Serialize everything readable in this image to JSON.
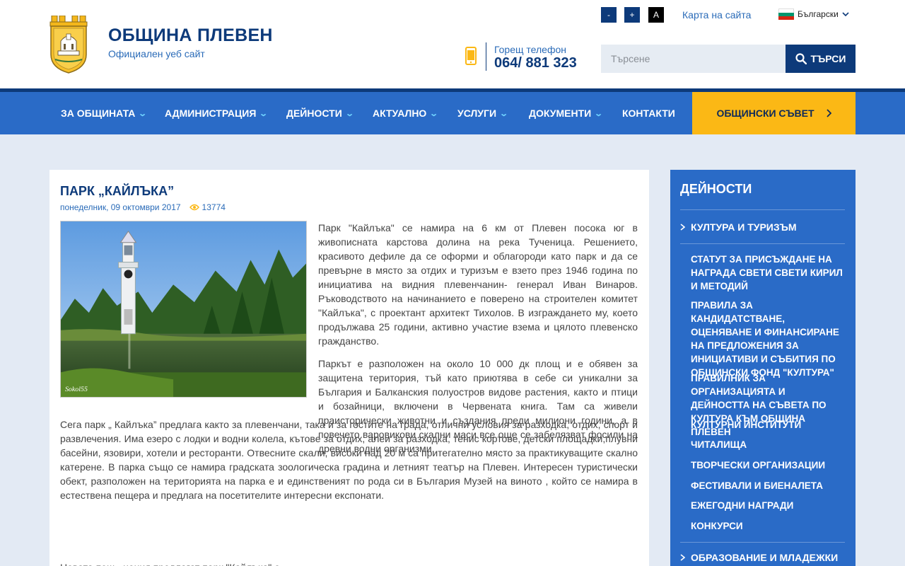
{
  "header": {
    "site_title": "ОБЩИНА ПЛЕВЕН",
    "site_subtitle": "Официален уеб сайт",
    "hotline_label": "Горещ телефон",
    "hotline_number": "064/ 881 323",
    "font_decrease": "-",
    "font_increase": "+",
    "contrast": "A",
    "sitemap": "Карта на сайта",
    "language": "Български",
    "search_placeholder": "Търсене",
    "search_button": "ТЪРСИ"
  },
  "nav": {
    "items": [
      {
        "label": "ЗА ОБЩИНАТА"
      },
      {
        "label": "АДМИНИСТРАЦИЯ"
      },
      {
        "label": "ДЕЙНОСТИ"
      },
      {
        "label": "АКТУАЛНО"
      },
      {
        "label": "УСЛУГИ"
      },
      {
        "label": "ДОКУМЕНТИ"
      },
      {
        "label": "КОНТАКТИ"
      }
    ],
    "council": "ОБЩИНСКИ СЪВЕТ"
  },
  "article": {
    "title": "ПАРК „КАЙЛЪКА”",
    "date": "понеделник, 09 октомври 2017",
    "views": "13774",
    "image_caption": "Sokol55",
    "paragraphs": [
      "Парк \"Кайлъка\" се намира на 6 км от Плевен посока юг  в живописната карстова долина на река Тученица. Решението, красивото дефиле да се оформи  и облагороди като парк и да се превърне в място за отдих и туризъм е взето през 1946 година по инициатива на видния плевенчанин- генерал Иван Винаров. Ръководството на начинанието е поверено на строителен комитет \"Кайлъка\", с проектант архитект Тихолов. В изграждането му, което продължава 25 години, активно участие взема  и цялото плевенско гражданство.",
      "Паркът е разположен на около 10 000 дк площ и е обявен за защитена територия, тъй като приютява в себе си уникални за България и Балканския полуостров видове  растения, както и  птици и бозайници, включени в Червената книга. Там са живели праисторически животни и създания преди милиони години, а в повечето варовикови скални маси все още се забелязват фосили на древни водни организми.",
      "Сега парк „ Кайлъка” предлага  както за плевенчани, така и за гостите на града, отлични условия за разходка, отдих, спорт и развлечения. Има езеро с лодки и водни колела, кътове за отдих, алеи за разходка, тенис кортове, детски площадки,плувни басейни, язовири, хотели и ресторанти. Отвесните скали, високи над 20 м са притегателно място за практикуващите скално катерене. В парка също се намира  градската зоологическа градина и летният театър на Плевен. Интересен туристически обект, разположен на територията на парка е и единственият по рода си в България Музей на виното , който се намира в естествена пещера и предлага на посетителите интересни експонати.",
      "Новата пещ...нения предлагат парк \"Кайлъка\" е"
    ]
  },
  "sidebar": {
    "title": "ДЕЙНОСТИ",
    "category": "КУЛТУРА И ТУРИЗЪМ",
    "subitems": [
      "СТАТУТ ЗА ПРИСЪЖДАНЕ НА НАГРАДА СВЕТИ СВЕТИ КИРИЛ И МЕТОДИЙ",
      "ПРАВИЛА ЗА КАНДИДАТСТВАНЕ, ОЦЕНЯВАНЕ И ФИНАНСИРАНЕ НА ПРЕДЛОЖЕНИЯ ЗА ИНИЦИАТИВИ И СЪБИТИЯ ПО ОБЩИНСКИ ФОНД \"КУЛТУРА\"",
      "ПРАВИЛНИК ЗА ОРГАНИЗАЦИЯТА И ДЕЙНОСТТА НА СЪВЕТА ПО КУЛТУРА КЪМ ОБЩИНА ПЛЕВЕН",
      "КУЛТУРНИ ИНСТИТУТИ",
      "ЧИТАЛИЩА",
      "ТВОРЧЕСКИ ОРГАНИЗАЦИИ",
      "ФЕСТИВАЛИ И БИЕНАЛЕТА",
      "ЕЖЕГОДНИ НАГРАДИ",
      "КОНКУРСИ"
    ],
    "next_category": "ОБРАЗОВАНИЕ И МЛАДЕЖКИ"
  },
  "colors": {
    "primary_dark": "#0d3a7a",
    "primary": "#2a6bc7",
    "accent_yellow": "#fbb815",
    "page_bg": "#e3eaf4"
  }
}
